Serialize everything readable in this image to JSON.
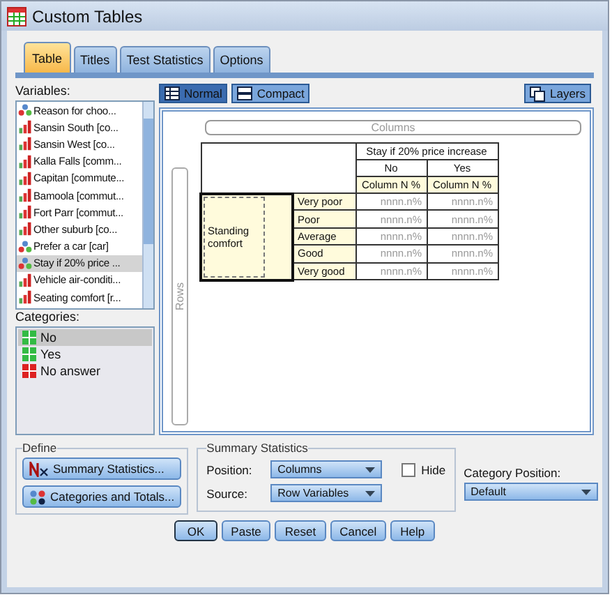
{
  "window": {
    "title": "Custom Tables"
  },
  "tabs": [
    {
      "label": "Table",
      "selected": true
    },
    {
      "label": "Titles",
      "selected": false
    },
    {
      "label": "Test Statistics",
      "selected": false
    },
    {
      "label": "Options",
      "selected": false
    }
  ],
  "variables": {
    "label": "Variables:",
    "items": [
      {
        "label": "Reason for choo...",
        "kind": "nominal",
        "selected": false
      },
      {
        "label": "Sansin South [co...",
        "kind": "scale",
        "selected": false
      },
      {
        "label": "Sansin West [co...",
        "kind": "scale",
        "selected": false
      },
      {
        "label": "Kalla Falls [comm...",
        "kind": "scale",
        "selected": false
      },
      {
        "label": "Capitan [commute...",
        "kind": "scale",
        "selected": false
      },
      {
        "label": "Bamoola [commut...",
        "kind": "scale",
        "selected": false
      },
      {
        "label": "Fort Parr [commut...",
        "kind": "scale",
        "selected": false
      },
      {
        "label": "Other suburb [co...",
        "kind": "scale",
        "selected": false
      },
      {
        "label": "Prefer a car [car]",
        "kind": "nominal",
        "selected": false
      },
      {
        "label": "Stay if 20% price ...",
        "kind": "nominal",
        "selected": true
      },
      {
        "label": "Vehicle air-conditi...",
        "kind": "scale",
        "selected": false
      },
      {
        "label": "Seating comfort [r...",
        "kind": "scale",
        "selected": false
      }
    ]
  },
  "categories": {
    "label": "Categories:",
    "items": [
      {
        "label": "No",
        "kind": "valid",
        "selected": true
      },
      {
        "label": "Yes",
        "kind": "valid",
        "selected": false
      },
      {
        "label": "No answer",
        "kind": "missing",
        "selected": false
      }
    ]
  },
  "view_buttons": [
    {
      "label": "Normal",
      "kind": "normal",
      "selected": true
    },
    {
      "label": "Compact",
      "kind": "compact",
      "selected": false
    }
  ],
  "layers_button": "Layers",
  "canvas": {
    "columns_label": "Columns",
    "rows_label": "Rows",
    "table": {
      "column_variable": "Stay if 20% price increase",
      "column_categories": [
        {
          "label": "No",
          "statistic": "Column N %"
        },
        {
          "label": "Yes",
          "statistic": "Column N %"
        }
      ],
      "row_variable": "Standing comfort",
      "rows": [
        {
          "label": "Very poor",
          "cells": [
            "nnnn.n%",
            "nnnn.n%"
          ]
        },
        {
          "label": "Poor",
          "cells": [
            "nnnn.n%",
            "nnnn.n%"
          ]
        },
        {
          "label": "Average",
          "cells": [
            "nnnn.n%",
            "nnnn.n%"
          ]
        },
        {
          "label": "Good",
          "cells": [
            "nnnn.n%",
            "nnnn.n%"
          ]
        },
        {
          "label": "Very good",
          "cells": [
            "nnnn.n%",
            "nnnn.n%"
          ]
        }
      ]
    }
  },
  "define": {
    "title": "Define",
    "buttons": [
      "Summary Statistics...",
      "Categories and Totals..."
    ]
  },
  "summary_statistics": {
    "title": "Summary Statistics",
    "position_label": "Position:",
    "position": "Columns",
    "source_label": "Source:",
    "source": "Row Variables",
    "hide": {
      "label": "Hide",
      "checked": false
    }
  },
  "category_position": {
    "label": "Category Position:",
    "value": "Default"
  },
  "buttons": [
    "OK",
    "Paste",
    "Reset",
    "Cancel",
    "Help"
  ]
}
